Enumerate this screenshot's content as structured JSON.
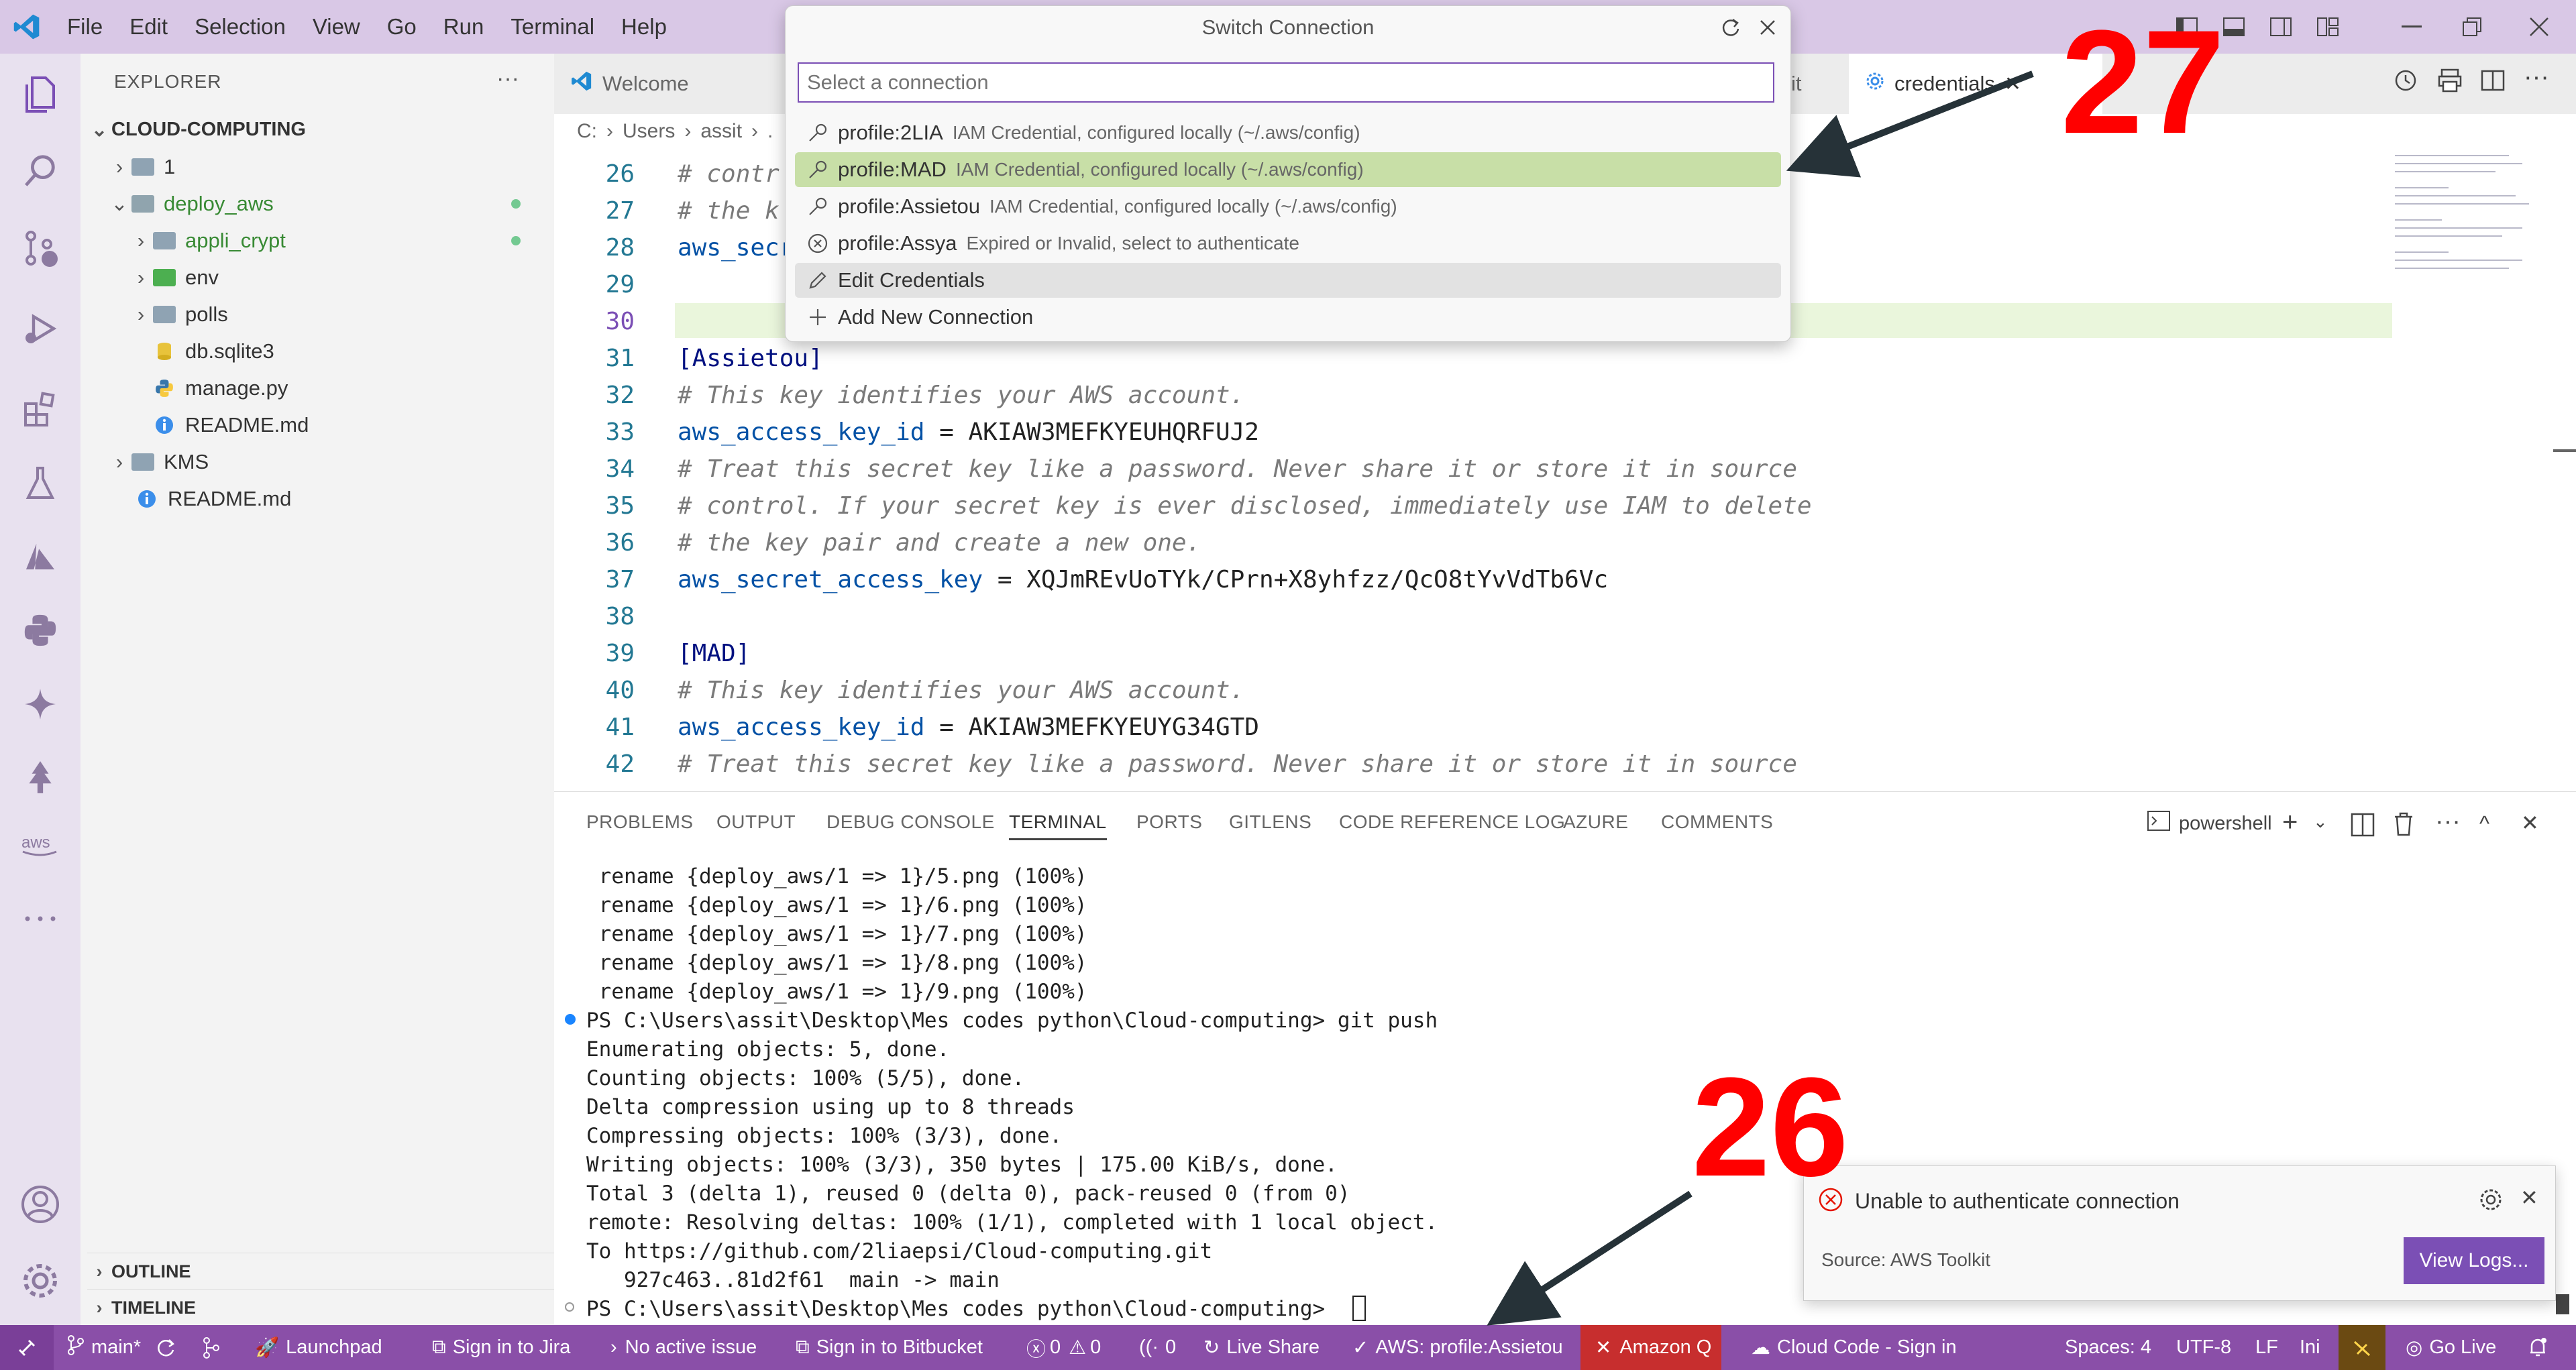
{
  "menu": [
    "File",
    "Edit",
    "Selection",
    "View",
    "Go",
    "Run",
    "Terminal",
    "Help"
  ],
  "sidebar": {
    "title": "EXPLORER",
    "more": "···",
    "root": "CLOUD-COMPUTING",
    "items": [
      {
        "label": "1"
      },
      {
        "label": "deploy_aws"
      },
      {
        "label": "appli_crypt"
      },
      {
        "label": "env"
      },
      {
        "label": "polls"
      },
      {
        "label": "db.sqlite3"
      },
      {
        "label": "manage.py"
      },
      {
        "label": "README.md"
      },
      {
        "label": "KMS"
      },
      {
        "label": "README.md"
      }
    ],
    "outline": "OUTLINE",
    "timeline": "TIMELINE"
  },
  "tabs": {
    "welcome": "Welcome",
    "partial": "it",
    "credentials": "credentials"
  },
  "breadcrumb": [
    "C:",
    "Users",
    "assit",
    "."
  ],
  "editor": {
    "lines": [
      {
        "n": "26",
        "parts": [
          {
            "t": "# contr",
            "c": "cmt"
          }
        ]
      },
      {
        "n": "27",
        "parts": [
          {
            "t": "# the k",
            "c": "cmt"
          }
        ]
      },
      {
        "n": "28",
        "parts": [
          {
            "t": "aws_secr",
            "c": "key"
          }
        ]
      },
      {
        "n": "29",
        "parts": []
      },
      {
        "n": "30",
        "parts": []
      },
      {
        "n": "31",
        "parts": [
          {
            "t": "[Assietou]",
            "c": "sec"
          }
        ]
      },
      {
        "n": "32",
        "parts": [
          {
            "t": "# This key identifies your AWS account.",
            "c": "cmt"
          }
        ]
      },
      {
        "n": "33",
        "parts": [
          {
            "t": "aws_access_key_id",
            "c": "key"
          },
          {
            "t": " = AKIAW3MEFKYEUHQRFUJ2",
            "c": "val"
          }
        ]
      },
      {
        "n": "34",
        "parts": [
          {
            "t": "# Treat this secret key like a password. Never share it or store it in source",
            "c": "cmt"
          }
        ]
      },
      {
        "n": "35",
        "parts": [
          {
            "t": "# control. If your secret key is ever disclosed, immediately use IAM to delete",
            "c": "cmt"
          }
        ]
      },
      {
        "n": "36",
        "parts": [
          {
            "t": "# the key pair and create a new one.",
            "c": "cmt"
          }
        ]
      },
      {
        "n": "37",
        "parts": [
          {
            "t": "aws_secret_access_key",
            "c": "key"
          },
          {
            "t": " = XQJmREvUoTYk/CPrn+X8yhfzz/QcO8tYvVdTb6Vc",
            "c": "val"
          }
        ]
      },
      {
        "n": "38",
        "parts": []
      },
      {
        "n": "39",
        "parts": [
          {
            "t": "[MAD]",
            "c": "sec"
          }
        ]
      },
      {
        "n": "40",
        "parts": [
          {
            "t": "# This key identifies your AWS account.",
            "c": "cmt"
          }
        ]
      },
      {
        "n": "41",
        "parts": [
          {
            "t": "aws_access_key_id",
            "c": "key"
          },
          {
            "t": " = AKIAW3MEFKYEUYG34GTD",
            "c": "val"
          }
        ]
      },
      {
        "n": "42",
        "parts": [
          {
            "t": "# Treat this secret key like a password. Never share it or store it in source",
            "c": "cmt"
          }
        ]
      }
    ]
  },
  "quickpick": {
    "title": "Switch Connection",
    "placeholder": "Select a connection",
    "items": [
      {
        "label": "profile:2LIA",
        "desc": "IAM Credential, configured locally (~/.aws/config)",
        "icon": "key-icon"
      },
      {
        "label": "profile:MAD",
        "desc": "IAM Credential, configured locally (~/.aws/config)",
        "icon": "key-icon"
      },
      {
        "label": "profile:Assietou",
        "desc": "IAM Credential, configured locally (~/.aws/config)",
        "icon": "key-icon"
      },
      {
        "label": "profile:Assya",
        "desc": "Expired or Invalid, select to authenticate",
        "icon": "error-circle-icon"
      },
      {
        "label": "Edit Credentials",
        "desc": "",
        "icon": "pencil-icon"
      },
      {
        "label": "Add New Connection",
        "desc": "",
        "icon": "plus-icon"
      }
    ]
  },
  "panel": {
    "tabs": [
      "PROBLEMS",
      "OUTPUT",
      "DEBUG CONSOLE",
      "TERMINAL",
      "PORTS",
      "GITLENS",
      "CODE REFERENCE LOG",
      "AZURE",
      "COMMENTS"
    ],
    "active_tab": "TERMINAL",
    "shell": "powershell",
    "terminal": [
      " rename {deploy_aws/1 => 1}/5.png (100%)",
      " rename {deploy_aws/1 => 1}/6.png (100%)",
      " rename {deploy_aws/1 => 1}/7.png (100%)",
      " rename {deploy_aws/1 => 1}/8.png (100%)",
      " rename {deploy_aws/1 => 1}/9.png (100%)",
      "PS C:\\Users\\assit\\Desktop\\Mes codes python\\Cloud-computing> git push",
      "Enumerating objects: 5, done.",
      "Counting objects: 100% (5/5), done.",
      "Delta compression using up to 8 threads",
      "Compressing objects: 100% (3/3), done.",
      "Writing objects: 100% (3/3), 350 bytes | 175.00 KiB/s, done.",
      "Total 3 (delta 1), reused 0 (delta 0), pack-reused 0 (from 0)",
      "remote: Resolving deltas: 100% (1/1), completed with 1 local object.",
      "To https://github.com/2liaepsi/Cloud-computing.git",
      "   927c463..81d2f61  main -> main",
      "PS C:\\Users\\assit\\Desktop\\Mes codes python\\Cloud-computing> "
    ]
  },
  "notification": {
    "message": "Unable to authenticate connection",
    "source": "Source: AWS Toolkit",
    "button": "View Logs..."
  },
  "statusbar": {
    "branch": "main*",
    "launchpad": "Launchpad",
    "jira": "Sign in to Jira",
    "issue": "No active issue",
    "bitbucket": "Sign in to Bitbucket",
    "errors": "0",
    "warnings": "0",
    "ports": "0",
    "liveshare": "Live Share",
    "aws": "AWS: profile:Assietou",
    "amazonq": "Amazon Q",
    "cloudcode": "Cloud Code - Sign in",
    "spaces": "Spaces: 4",
    "encoding": "UTF-8",
    "eol": "LF",
    "lang": "Ini",
    "golive": "Go Live"
  },
  "annotations": {
    "top": "27",
    "bottom": "26"
  },
  "colors": {
    "statusbar": "#8a4fa8",
    "accent": "#7b4fb5",
    "selection": "#c8dfa7",
    "error": "#e51400",
    "annotation": "#ff0000"
  }
}
